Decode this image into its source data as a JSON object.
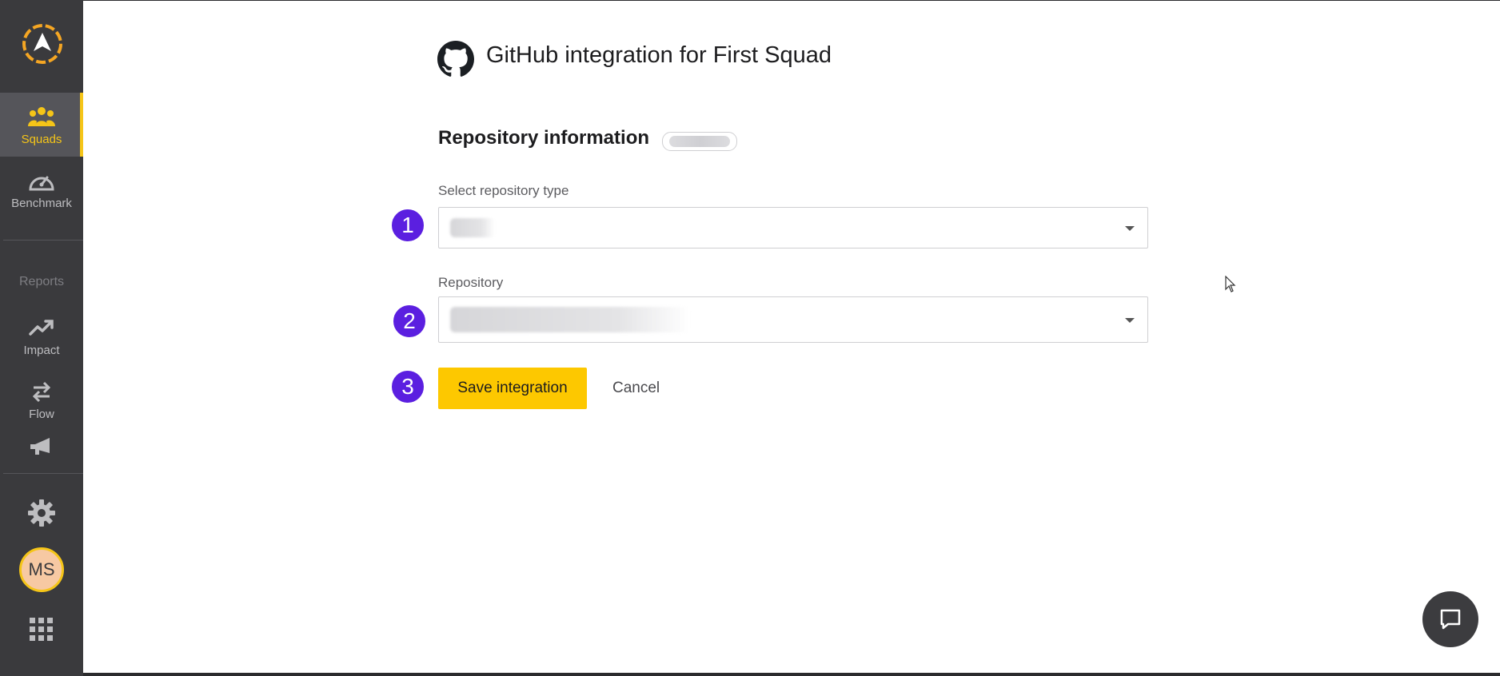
{
  "colors": {
    "sidebar_bg": "#3a3a3d",
    "accent": "#f5c518",
    "primary_button": "#fdc800",
    "step_badge": "#5b1fe0"
  },
  "sidebar": {
    "items": [
      {
        "label": "Squads",
        "icon": "people-icon",
        "active": true
      },
      {
        "label": "Benchmark",
        "icon": "speedometer-icon",
        "active": false
      }
    ],
    "reports_label": "Reports",
    "report_items": [
      {
        "label": "Impact",
        "icon": "trending-up-icon"
      },
      {
        "label": "Flow",
        "icon": "swap-arrows-icon"
      },
      {
        "label": "",
        "icon": "megaphone-icon"
      }
    ],
    "settings_icon": "gear-icon",
    "avatar_initials": "MS",
    "apps_icon": "grid-icon"
  },
  "main": {
    "title": "GitHub integration for First Squad",
    "section_title": "Repository information",
    "repo_type": {
      "label": "Select repository type",
      "value": ""
    },
    "repository": {
      "label": "Repository",
      "value": ""
    },
    "steps": [
      "1",
      "2",
      "3"
    ],
    "save_label": "Save integration",
    "cancel_label": "Cancel"
  }
}
